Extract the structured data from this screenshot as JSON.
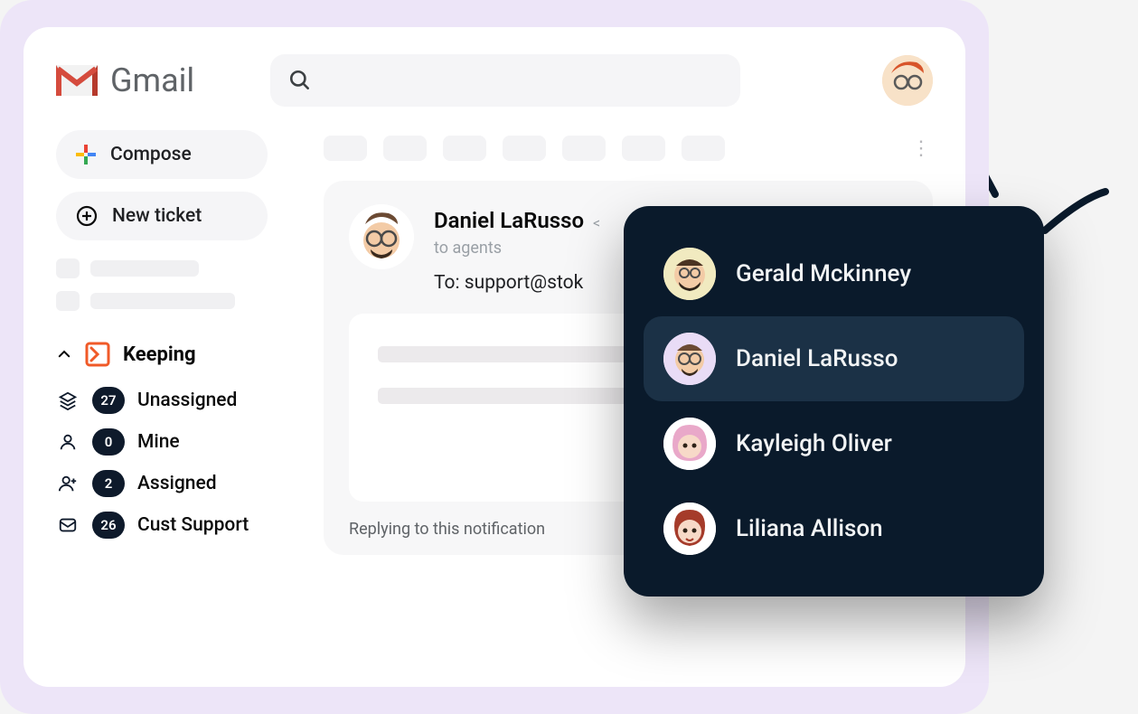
{
  "header": {
    "logo_text": "Gmail",
    "search_placeholder": ""
  },
  "sidebar": {
    "compose_label": "Compose",
    "new_ticket_label": "New ticket",
    "section_title": "Keeping",
    "items": [
      {
        "icon": "stack-icon",
        "badge": "27",
        "label": "Unassigned"
      },
      {
        "icon": "person-icon",
        "badge": "0",
        "label": "Mine"
      },
      {
        "icon": "person-plus-icon",
        "badge": "2",
        "label": "Assigned"
      },
      {
        "icon": "envelope-icon",
        "badge": "26",
        "label": "Cust Support"
      }
    ]
  },
  "message": {
    "sender_name": "Daniel LaRusso",
    "recipients_label": "to agents",
    "to_line": "To: support@stok",
    "reply_hint": "Replying to this notification"
  },
  "popup": {
    "people": [
      {
        "name": "Gerald Mckinney",
        "avatar_bg": "#f1eac0",
        "selected": false
      },
      {
        "name": "Daniel LaRusso",
        "avatar_bg": "#e9dcf6",
        "selected": true
      },
      {
        "name": "Kayleigh Oliver",
        "avatar_bg": "#ffffff",
        "selected": false
      },
      {
        "name": "Liliana Allison",
        "avatar_bg": "#ffffff",
        "selected": false
      }
    ]
  },
  "colors": {
    "outer_bg": "#ede5f8",
    "popup_bg": "#0a1a2b",
    "badge_bg": "#0e1a2b",
    "keeping_orange": "#f05a28"
  }
}
